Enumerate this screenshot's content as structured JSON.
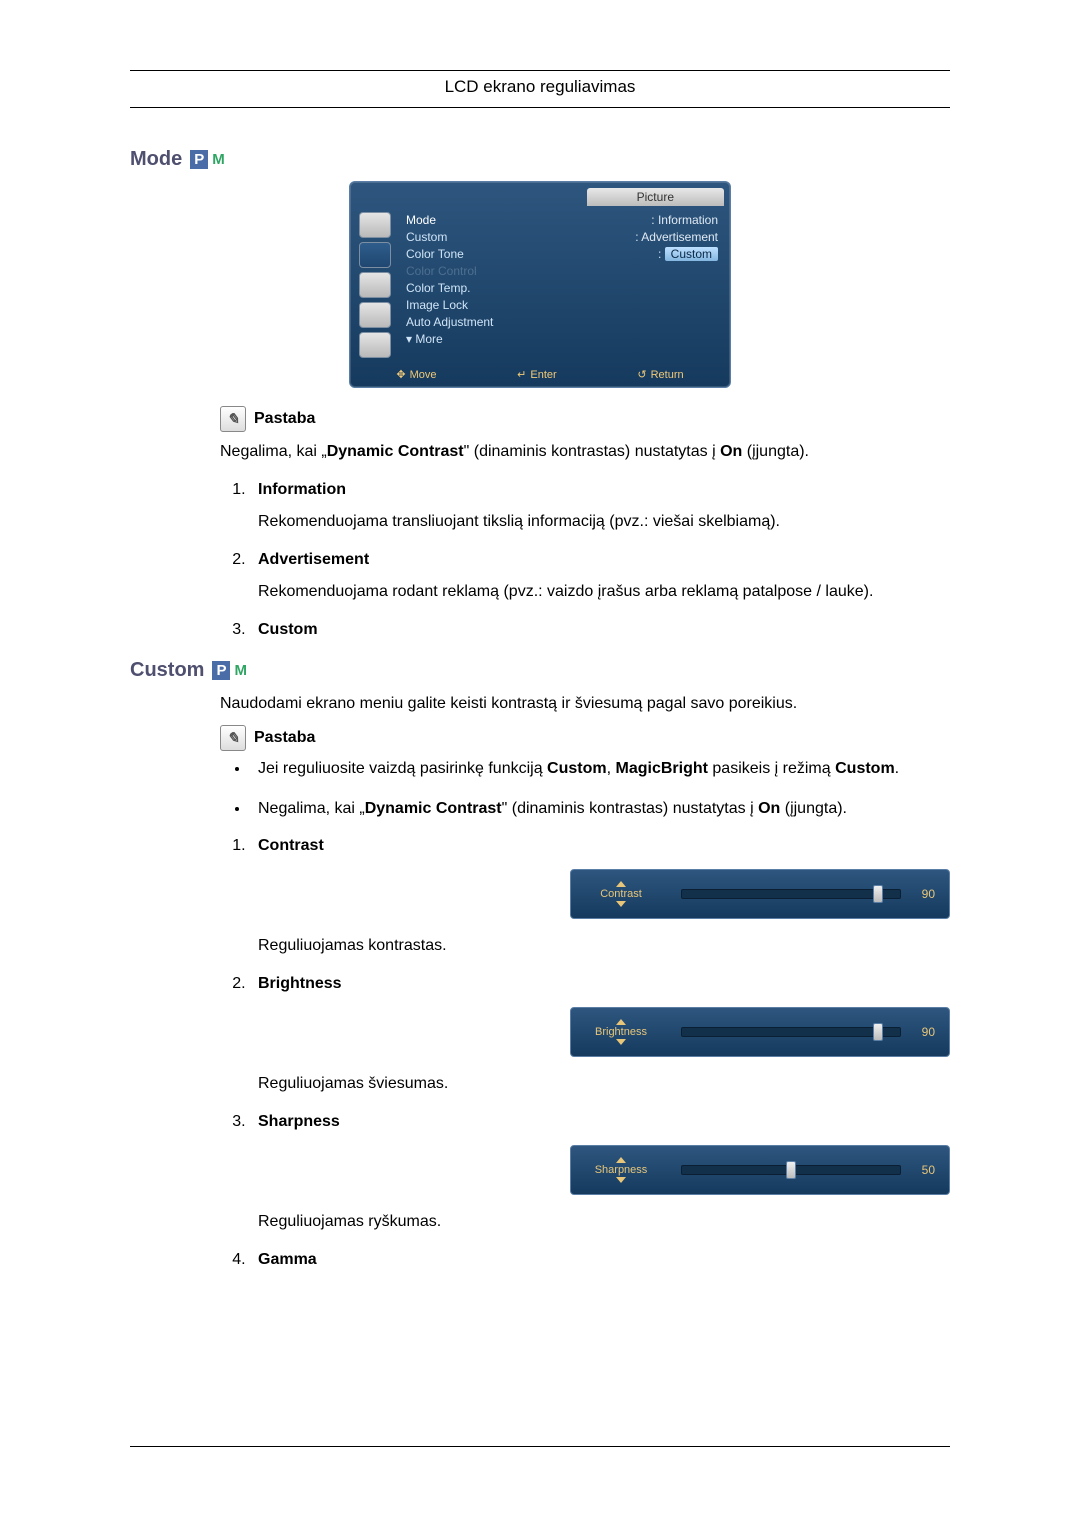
{
  "header": {
    "title": "LCD ekrano reguliavimas"
  },
  "note_label": "Pastaba",
  "badge": {
    "p": "P",
    "m": "M"
  },
  "sections": {
    "mode": {
      "heading": "Mode",
      "osd": {
        "tab": "Picture",
        "items": [
          {
            "label": "Mode",
            "value": "Information",
            "sel": true,
            "val_hi": false
          },
          {
            "label": "Custom",
            "value": "Advertisement",
            "sel": false,
            "val_hi": false
          },
          {
            "label": "Color Tone",
            "value": "Custom",
            "sel": false,
            "val_hi": true
          },
          {
            "label": "Color Control",
            "value": "",
            "dim": true
          },
          {
            "label": "Color Temp.",
            "value": ""
          },
          {
            "label": "Image Lock",
            "value": ""
          },
          {
            "label": "Auto Adjustment",
            "value": ""
          },
          {
            "label": "More",
            "value": "",
            "caret": true
          }
        ],
        "footer": {
          "move": "Move",
          "enter": "Enter",
          "return": "Return"
        }
      },
      "note_text_prefix": "Negalima, kai „",
      "note_bold1": "Dynamic Contrast",
      "note_text_mid": "\" (dinaminis kontrastas) nustatytas į ",
      "note_bold2": "On",
      "note_text_suffix": " (įjungta).",
      "list": [
        {
          "title": "Information",
          "desc": "Rekomenduojama transliuojant tikslią informaciją (pvz.: viešai skelbiamą)."
        },
        {
          "title": "Advertisement",
          "desc": "Rekomenduojama rodant reklamą (pvz.: vaizdo įrašus arba reklamą patalpose / lauke)."
        },
        {
          "title": "Custom",
          "desc": ""
        }
      ]
    },
    "custom": {
      "heading": "Custom",
      "intro": "Naudodami ekrano meniu galite keisti kontrastą ir šviesumą pagal savo poreikius.",
      "bullets": {
        "b1_pre": "Jei reguliuosite vaizdą pasirinkę funkciją ",
        "b1_b1": "Custom",
        "b1_mid": ", ",
        "b1_b2": "MagicBright",
        "b1_mid2": " pasikeis į režimą ",
        "b1_b3": "Cus­tom",
        "b1_suf": ".",
        "b2_pre": "Negalima, kai „",
        "b2_b1": "Dynamic Contrast",
        "b2_mid": "\" (dinaminis kontrastas) nustatytas į ",
        "b2_b2": "On",
        "b2_suf": " (įjungta)."
      },
      "sliders": [
        {
          "title": "Contrast",
          "label": "Contrast",
          "value": 90,
          "desc": "Reguliuojamas kontrastas."
        },
        {
          "title": "Brightness",
          "label": "Brightness",
          "value": 90,
          "desc": "Reguliuojamas šviesumas."
        },
        {
          "title": "Sharpness",
          "label": "Sharpness",
          "value": 50,
          "desc": "Reguliuojamas ryškumas."
        },
        {
          "title": "Gamma",
          "label": "",
          "value": null,
          "desc": ""
        }
      ]
    }
  },
  "chart_data": [
    {
      "type": "bar",
      "title": "Contrast",
      "categories": [
        "Contrast"
      ],
      "values": [
        90
      ],
      "ylim": [
        0,
        100
      ],
      "xlabel": "",
      "ylabel": ""
    },
    {
      "type": "bar",
      "title": "Brightness",
      "categories": [
        "Brightness"
      ],
      "values": [
        90
      ],
      "ylim": [
        0,
        100
      ],
      "xlabel": "",
      "ylabel": ""
    },
    {
      "type": "bar",
      "title": "Sharpness",
      "categories": [
        "Sharpness"
      ],
      "values": [
        50
      ],
      "ylim": [
        0,
        100
      ],
      "xlabel": "",
      "ylabel": ""
    }
  ]
}
